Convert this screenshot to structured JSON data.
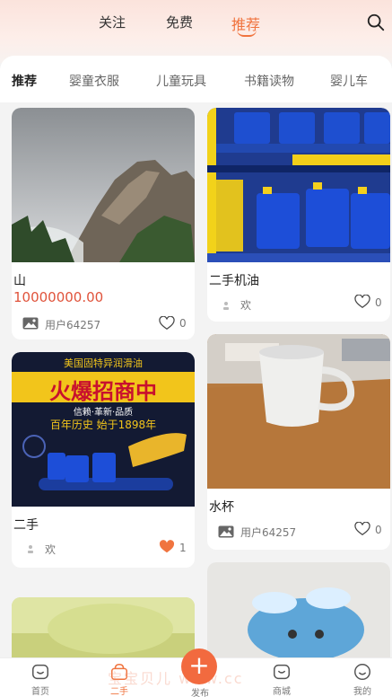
{
  "top_tabs": [
    "关注",
    "免费",
    "推荐"
  ],
  "categories": [
    "推荐",
    "婴童衣服",
    "儿童玩具",
    "书籍读物",
    "婴儿车"
  ],
  "cards": [
    {
      "title": "山",
      "price": "10000000.00",
      "user": "用户64257",
      "likes": "0"
    },
    {
      "title": "二手机油",
      "price": "",
      "user": "欢",
      "likes": "0"
    },
    {
      "title": "二手",
      "price": "",
      "user": "欢",
      "likes": "1"
    },
    {
      "title": "水杯",
      "price": "",
      "user": "用户64257",
      "likes": "0"
    }
  ],
  "ad_text": {
    "line1": "美国固特异润滑油",
    "line2": "火爆招商中",
    "line3": "信赖·革新·品质",
    "line4": "百年历史  始于1898年"
  },
  "bottom_nav": [
    "首页",
    "二手",
    "发布",
    "商城",
    "我的"
  ],
  "publish_symbol": "+",
  "watermark": "宝宝贝儿 www.cc",
  "colors": {
    "accent": "#f0743f",
    "price": "#e0533b",
    "like_active": "#f0743f"
  }
}
